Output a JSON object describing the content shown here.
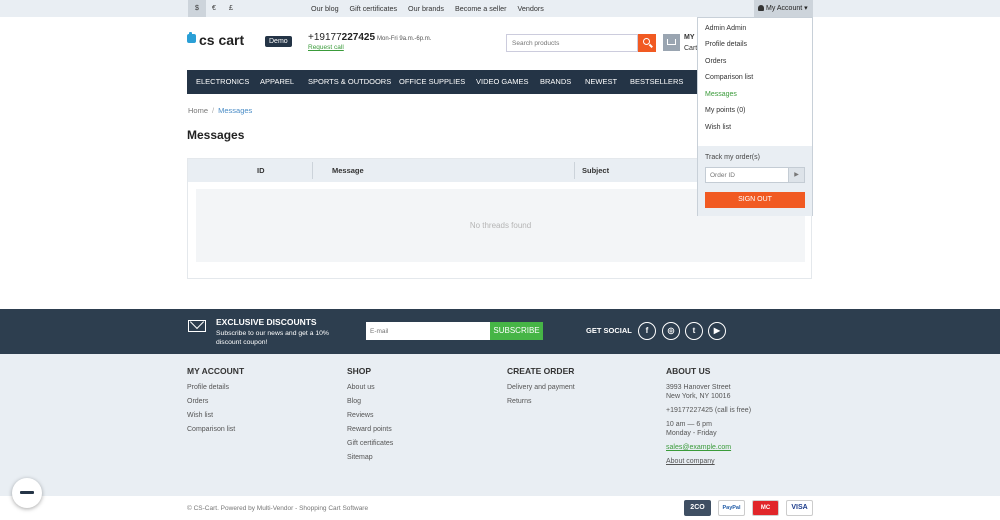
{
  "topbar": {
    "currencies": [
      "$",
      "€",
      "£"
    ],
    "links": [
      "Our blog",
      "Gift certificates",
      "Our brands",
      "Become a seller",
      "Vendors"
    ],
    "account_label": "My Account ▾"
  },
  "header": {
    "logo_text": "cs cart",
    "demo_badge": "Demo",
    "phone_prefix": "+19177",
    "phone_bold": "227425",
    "hours": "Mon-Fri 9a.m.-6p.m.",
    "request_call": "Request call",
    "search_placeholder": "Search products",
    "cart_title": "MY",
    "cart_sub": "Cart"
  },
  "nav": [
    "ELECTRONICS",
    "APPAREL",
    "SPORTS & OUTDOORS",
    "OFFICE SUPPLIES",
    "VIDEO GAMES",
    "BRANDS",
    "NEWEST",
    "BESTSELLERS"
  ],
  "breadcrumb": {
    "home": "Home",
    "sep": "/",
    "current": "Messages"
  },
  "page_title": "Messages",
  "table": {
    "columns": [
      "ID",
      "Message",
      "Subject"
    ],
    "empty_text": "No threads found"
  },
  "dropdown": {
    "items": [
      "Admin Admin",
      "Profile details",
      "Orders",
      "Comparison list",
      "Messages",
      "My points (0)",
      "Wish list"
    ],
    "active_index": 4,
    "track_label": "Track my order(s)",
    "order_placeholder": "Order ID",
    "go": "▶",
    "signout": "SIGN OUT"
  },
  "subscribe": {
    "title": "EXCLUSIVE DISCOUNTS",
    "text": "Subscribe to our news and get a 10% discount coupon!",
    "email_placeholder": "E-mail",
    "button": "SUBSCRIBE",
    "social_label": "GET SOCIAL",
    "social_icons": [
      "f",
      "◎",
      "t",
      "▶"
    ]
  },
  "footer": {
    "my_account": {
      "title": "MY ACCOUNT",
      "links": [
        "Profile details",
        "Orders",
        "Wish list",
        "Comparison list"
      ]
    },
    "shop": {
      "title": "SHOP",
      "links": [
        "About us",
        "Blog",
        "Reviews",
        "Reward points",
        "Gift certificates",
        "Sitemap"
      ]
    },
    "create_order": {
      "title": "CREATE ORDER",
      "links": [
        "Delivery and payment",
        "Returns"
      ]
    },
    "about": {
      "title": "ABOUT US",
      "address1": "3993 Hanover Street",
      "address2": "New York, NY 10016",
      "phone": "+19177227425 (call is free)",
      "hours1": "10 am — 6 pm",
      "hours2": "Monday - Friday",
      "email": "sales@example.com",
      "company": "About company"
    }
  },
  "bottom": {
    "copyright": "© CS-Cart.  Powered by Multi-Vendor - Shopping Cart Software",
    "payments": [
      "2CO",
      "PayPal",
      "MC",
      "VISA"
    ]
  },
  "colors": {
    "accent": "#f15a22",
    "nav_bg": "#243446",
    "green": "#46b546",
    "topbar_bg": "#e9eef3"
  }
}
